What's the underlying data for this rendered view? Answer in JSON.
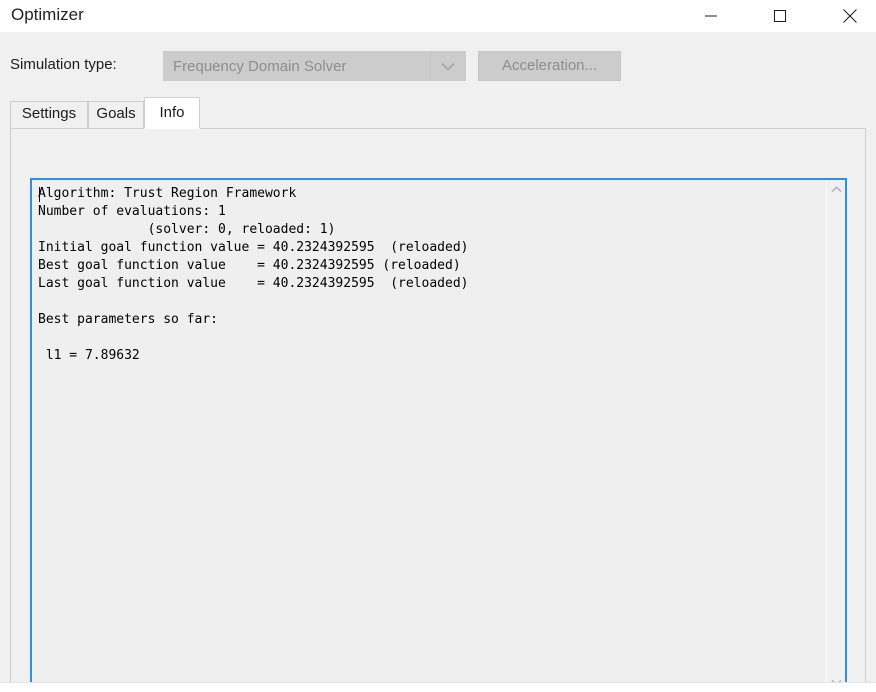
{
  "window": {
    "title": "Optimizer",
    "controls": {
      "minimize": "minimize-icon",
      "maximize": "maximize-icon",
      "close": "close-icon"
    }
  },
  "toolbar": {
    "simulation_type_label": "Simulation type:",
    "simulation_type_value": "Frequency Domain Solver",
    "simulation_type_disabled": true,
    "dropdown_icon": "chevron-down-icon",
    "acceleration_label": "Acceleration...",
    "acceleration_disabled": true
  },
  "tabs": [
    {
      "label": "Settings",
      "selected": false
    },
    {
      "label": "Goals",
      "selected": false
    },
    {
      "label": "Info",
      "selected": true
    }
  ],
  "info_panel": {
    "text": "Algorithm: Trust Region Framework\nNumber of evaluations: 1\n              (solver: 0, reloaded: 1)\nInitial goal function value = 40.2324392595  (reloaded)\nBest goal function value    = 40.2324392595 (reloaded)\nLast goal function value    = 40.2324392595  (reloaded)\n\nBest parameters so far:\n\n l1 = 7.89632",
    "lines": [
      "Algorithm: Trust Region Framework",
      "Number of evaluations: 1",
      "              (solver: 0, reloaded: 1)",
      "Initial goal function value = 40.2324392595  (reloaded)",
      "Best goal function value    = 40.2324392595 (reloaded)",
      "Last goal function value    = 40.2324392595  (reloaded)",
      "",
      "Best parameters so far:",
      "",
      " l1 = 7.89632"
    ],
    "algorithm": "Trust Region Framework",
    "number_of_evaluations": "1",
    "solver_count": "0",
    "reloaded_count": "1",
    "initial_goal_function_value": "40.2324392595",
    "best_goal_function_value": "40.2324392595",
    "last_goal_function_value": "40.2324392595",
    "best_parameters_heading": "Best parameters so far:",
    "parameters": [
      {
        "name": "l1",
        "value": "7.89632"
      }
    ],
    "scrollbar": {
      "up_icon": "chevron-up-icon",
      "down_icon": "chevron-down-icon"
    }
  },
  "colors": {
    "accent_focus_border": "#2f8fe0",
    "dialog_background": "#f0f0f0",
    "textarea_background": "#efefef",
    "disabled_control": "#cccccc",
    "disabled_text": "#8d8d8d",
    "titlebar_background": "#ffffff"
  }
}
